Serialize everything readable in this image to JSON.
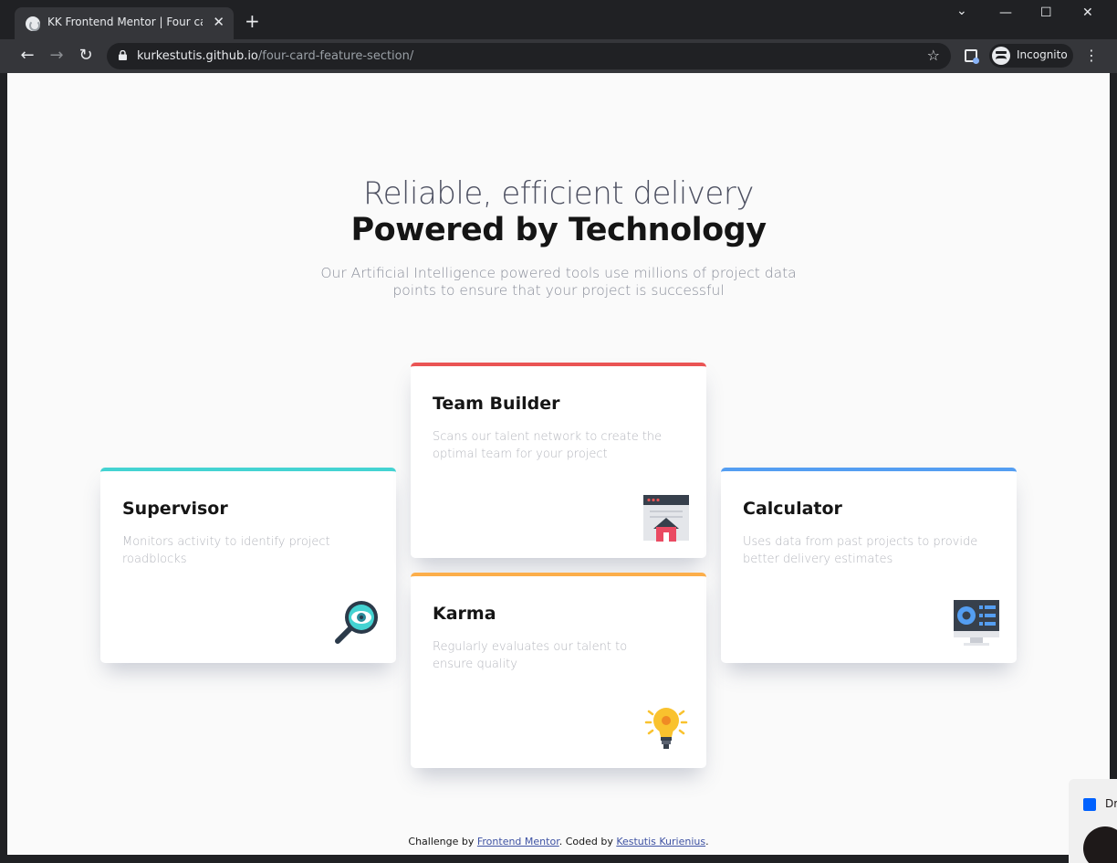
{
  "browser": {
    "tab_title": "KK Frontend Mentor | Four card f",
    "tab_close": "✕",
    "new_tab": "+",
    "window_minimize": "—",
    "window_maximize": "☐",
    "window_close": "✕",
    "window_tab_search": "⌄",
    "url_host": "kurkestutis.github.io",
    "url_path": "/four-card-feature-section/",
    "incognito_label": "Incognito"
  },
  "hero": {
    "line1": "Reliable, efficient delivery",
    "line2": "Powered by Technology",
    "description": "Our Artificial Intelligence powered tools use millions of project data points to ensure that your project is successful"
  },
  "cards": [
    {
      "title": "Supervisor",
      "description": "Monitors activity to identify project roadblocks",
      "accent": "#44d3d2",
      "icon": "magnifier-eye-icon"
    },
    {
      "title": "Team Builder",
      "description": "Scans our talent network to create the optimal team for your project",
      "accent": "#ea5454",
      "icon": "browser-house-icon"
    },
    {
      "title": "Karma",
      "description": "Regularly evaluates our talent to ensure quality",
      "accent": "#fcae4a",
      "icon": "lightbulb-icon"
    },
    {
      "title": "Calculator",
      "description": "Uses data from past projects to provide better delivery estimates",
      "accent": "#549ef2",
      "icon": "monitor-chart-icon"
    }
  ],
  "footer": {
    "prefix": "Challenge by ",
    "link1": "Frontend Mentor",
    "middle": ". Coded by ",
    "link2": "Kestutis Kurienius",
    "suffix": "."
  },
  "dropbox": {
    "label": "Dr"
  }
}
